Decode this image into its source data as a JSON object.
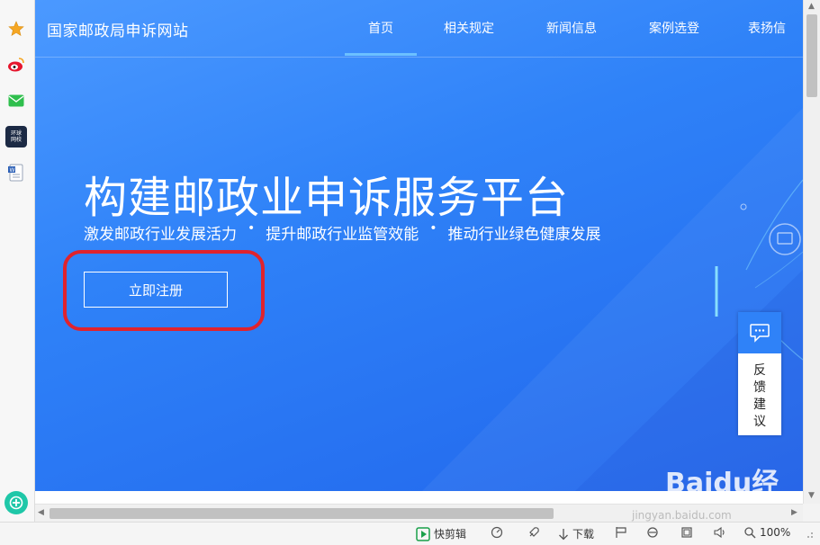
{
  "site": {
    "title": "国家邮政局申诉网站"
  },
  "nav": [
    {
      "label": "首页",
      "active": true
    },
    {
      "label": "相关规定",
      "active": false
    },
    {
      "label": "新闻信息",
      "active": false
    },
    {
      "label": "案例选登",
      "active": false
    },
    {
      "label": "表扬信",
      "active": false
    }
  ],
  "hero": {
    "headline": "构建邮政业申诉服务平台",
    "sub": [
      "激发邮政行业发展活力",
      "提升邮政行业监管效能",
      "推动行业绿色健康发展"
    ],
    "separator": "•",
    "register_label": "立即注册"
  },
  "feedback": {
    "label": "反馈建议"
  },
  "sidebar": {
    "news_icon_text": "环球网校"
  },
  "statusbar": {
    "clip_label": "快剪辑",
    "download_label": "下载",
    "zoom": "100%"
  },
  "watermark": {
    "text": "Baidu经验",
    "sub": "jingyan.baidu.com"
  },
  "colors": {
    "hero_top": "#4b99ff",
    "hero_bottom": "#2166ec",
    "highlight": "#e0232d",
    "accent": "#2f82f8"
  }
}
